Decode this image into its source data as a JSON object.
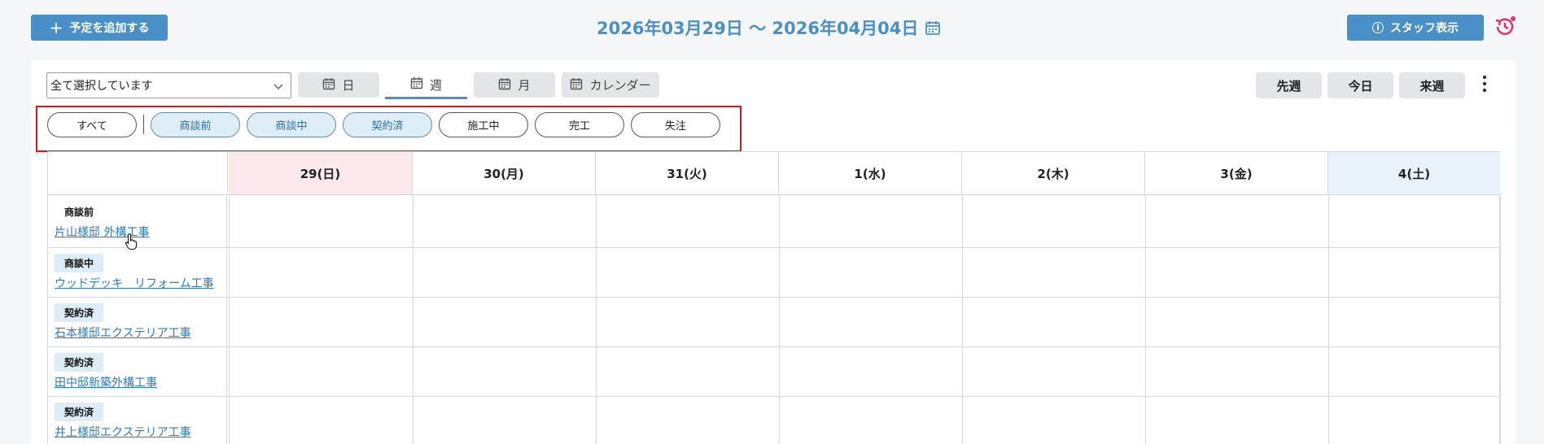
{
  "header": {
    "add_label": "予定を追加する",
    "date_range": "2026年03月29日 ～ 2026年04月04日",
    "staff_label": "スタッフ表示"
  },
  "toolbar": {
    "select_value": "全て選択しています",
    "views": [
      {
        "label": "日",
        "active": false
      },
      {
        "label": "週",
        "active": true
      },
      {
        "label": "月",
        "active": false
      },
      {
        "label": "カレンダー",
        "active": false
      }
    ],
    "nav": {
      "prev": "先週",
      "today": "今日",
      "next": "来週"
    }
  },
  "filters": [
    {
      "label": "すべて",
      "on": false
    },
    {
      "label": "商談前",
      "on": true
    },
    {
      "label": "商談中",
      "on": true
    },
    {
      "label": "契約済",
      "on": true
    },
    {
      "label": "施工中",
      "on": false
    },
    {
      "label": "完工",
      "on": false
    },
    {
      "label": "失注",
      "on": false
    }
  ],
  "days": [
    {
      "label": "29(日)",
      "bg": "#fbe9ec"
    },
    {
      "label": "30(月)",
      "bg": "#ffffff"
    },
    {
      "label": "31(火)",
      "bg": "#ffffff"
    },
    {
      "label": "1(水)",
      "bg": "#ffffff"
    },
    {
      "label": "2(木)",
      "bg": "#ffffff"
    },
    {
      "label": "3(金)",
      "bg": "#ffffff"
    },
    {
      "label": "4(土)",
      "bg": "#eaf2f9"
    }
  ],
  "projects": [
    {
      "status": "商談前",
      "name": "片山様邸 外構工事"
    },
    {
      "status": "商談中",
      "name": "ウッドデッキ　リフォーム工事"
    },
    {
      "status": "契約済",
      "name": "石本様邸エクステリア工事"
    },
    {
      "status": "契約済",
      "name": "田中邸新築外構工事"
    },
    {
      "status": "契約済",
      "name": "井上様邸エクステリア工事"
    }
  ],
  "colors": {
    "accent": "#4a90c8",
    "highlight": "#d6151b",
    "history": "#e0336b"
  }
}
